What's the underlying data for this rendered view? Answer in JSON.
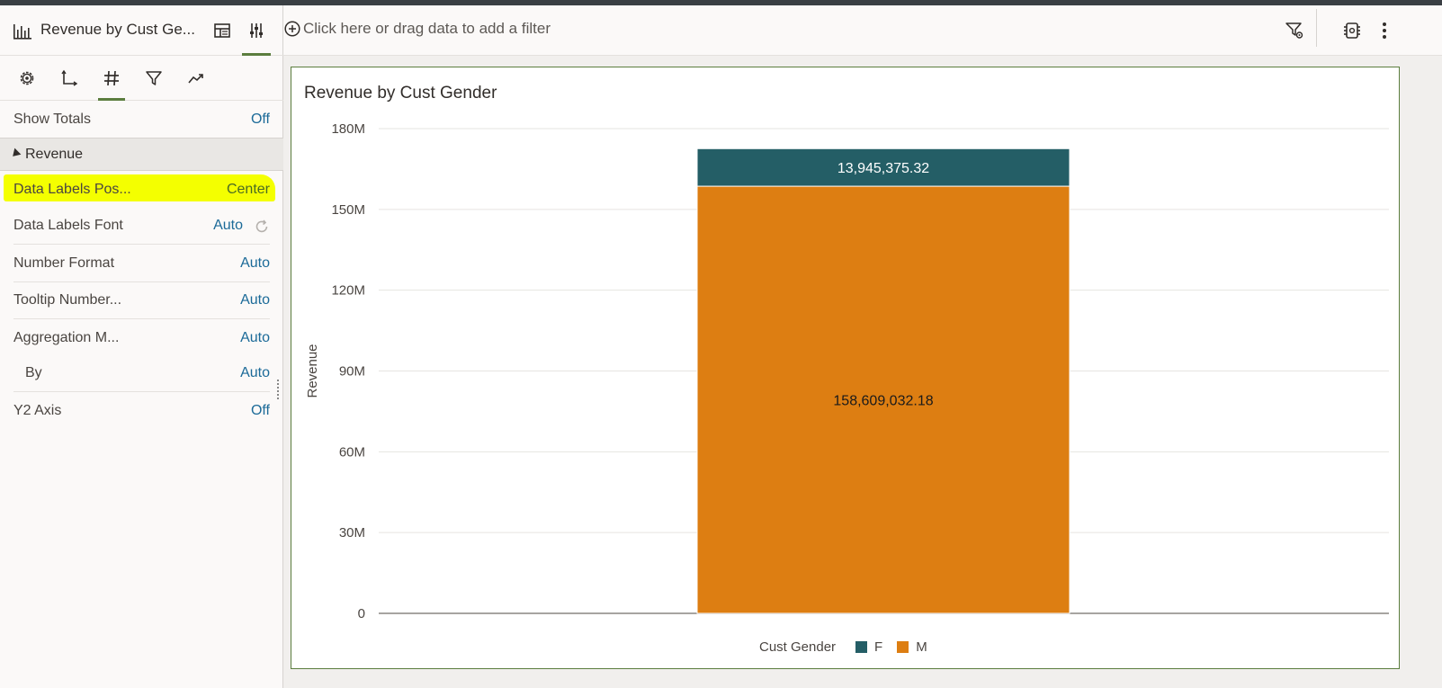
{
  "panel": {
    "title": "Revenue by Cust Ge...",
    "tabs": [
      "settings-icon",
      "axis-icon",
      "hash-icon",
      "filter-icon",
      "trend-icon"
    ],
    "show_totals": {
      "label": "Show Totals",
      "value": "Off"
    },
    "section": "Revenue",
    "properties": [
      {
        "label": "Data Labels Pos...",
        "value": "Center"
      },
      {
        "label": "Data Labels Font",
        "value": "Auto"
      },
      {
        "label": "Number Format",
        "value": "Auto"
      },
      {
        "label": "Tooltip Number...",
        "value": "Auto"
      },
      {
        "label": "Aggregation M...",
        "value": "Auto"
      },
      {
        "label": "By",
        "value": "Auto"
      },
      {
        "label": "Y2 Axis",
        "value": "Off"
      }
    ]
  },
  "filterbar": {
    "placeholder": "Click here or drag data to add a filter"
  },
  "colors": {
    "accent": "#5b7d3e",
    "highlight": "#f4ff00",
    "series_f": "#245e66",
    "series_m": "#dd7e12",
    "link": "#1b6a98"
  },
  "viz": {
    "title": "Revenue by Cust Gender"
  },
  "chart_data": {
    "type": "bar",
    "stacked": true,
    "title": "Revenue by Cust Gender",
    "xlabel": "",
    "ylabel": "Revenue",
    "ylim": [
      0,
      180000000
    ],
    "yticks": [
      "0",
      "30M",
      "60M",
      "90M",
      "120M",
      "150M",
      "180M"
    ],
    "ytick_values": [
      0,
      30000000,
      60000000,
      90000000,
      120000000,
      150000000,
      180000000
    ],
    "categories": [
      ""
    ],
    "series": [
      {
        "name": "M",
        "values": [
          158609032.18
        ],
        "label": "158,609,032.18",
        "color": "#dd7e12"
      },
      {
        "name": "F",
        "values": [
          13945375.32
        ],
        "label": "13,945,375.32",
        "color": "#245e66"
      }
    ],
    "legend": {
      "title": "Cust Gender",
      "entries": [
        "F",
        "M"
      ],
      "placement": "bottom"
    },
    "grid": true
  }
}
